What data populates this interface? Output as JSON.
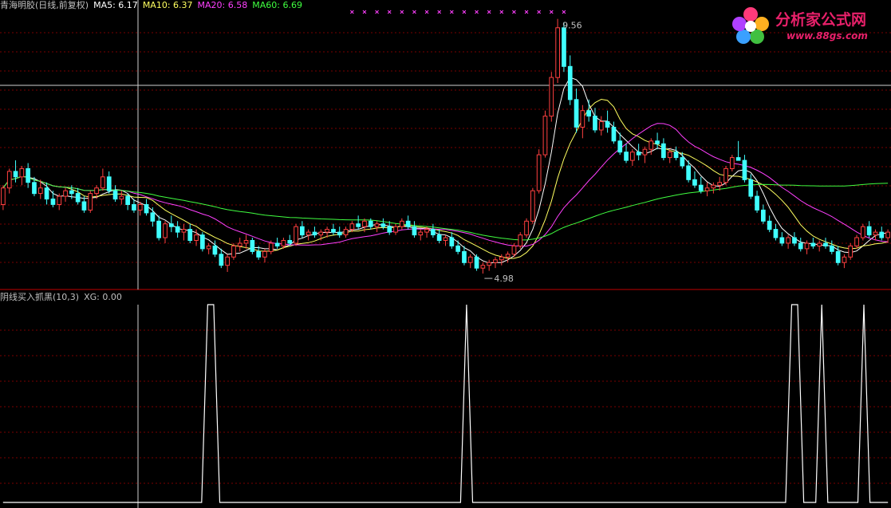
{
  "header": {
    "stock": "青海明胶(日线,前复权)",
    "ma5": "MA5: 6.17",
    "ma10": "MA10: 6.37",
    "ma20": "MA20: 6.58",
    "ma60": "MA60: 6.69"
  },
  "indicator_header": {
    "name": "阴线买入抓黑(10,3)",
    "xg": "XG: 0.00"
  },
  "logo": {
    "text": "分析家公式网",
    "url": "www.88gs.com"
  },
  "colors": {
    "up": "#ff4040",
    "down": "#40ffff",
    "ma5": "#ffffff",
    "ma10": "#ffff60",
    "ma20": "#ff40ff",
    "ma60": "#40ff40",
    "grid": "#7a0000",
    "signal": "#ffffff",
    "logo": "#e8206a"
  },
  "chart_data": [
    {
      "type": "candlestick",
      "title": "青海明胶(日线,前复权)",
      "annotations": [
        {
          "label": "9.56",
          "kind": "high"
        },
        {
          "label": "4.98",
          "kind": "low"
        }
      ],
      "series": [
        {
          "name": "MA5",
          "value": 6.17
        },
        {
          "name": "MA10",
          "value": 6.37
        },
        {
          "name": "MA20",
          "value": 6.58
        },
        {
          "name": "MA60",
          "value": 6.69
        }
      ],
      "ylim": [
        4.85,
        9.7
      ],
      "bars": [
        [
          6.2,
          6.55,
          6.1,
          6.5
        ],
        [
          6.5,
          6.85,
          6.4,
          6.8
        ],
        [
          6.8,
          7.0,
          6.6,
          6.7
        ],
        [
          6.7,
          6.9,
          6.55,
          6.85
        ],
        [
          6.85,
          6.95,
          6.5,
          6.6
        ],
        [
          6.6,
          6.7,
          6.35,
          6.4
        ],
        [
          6.4,
          6.65,
          6.3,
          6.5
        ],
        [
          6.5,
          6.6,
          6.2,
          6.3
        ],
        [
          6.3,
          6.45,
          6.15,
          6.2
        ],
        [
          6.2,
          6.4,
          6.1,
          6.35
        ],
        [
          6.35,
          6.5,
          6.25,
          6.45
        ],
        [
          6.45,
          6.55,
          6.3,
          6.4
        ],
        [
          6.4,
          6.5,
          6.2,
          6.25
        ],
        [
          6.25,
          6.35,
          6.05,
          6.1
        ],
        [
          6.1,
          6.45,
          6.05,
          6.4
        ],
        [
          6.4,
          6.55,
          6.3,
          6.5
        ],
        [
          6.5,
          6.85,
          6.45,
          6.7
        ],
        [
          6.7,
          6.8,
          6.4,
          6.45
        ],
        [
          6.45,
          6.55,
          6.25,
          6.3
        ],
        [
          6.3,
          6.45,
          6.2,
          6.35
        ],
        [
          6.35,
          6.4,
          6.1,
          6.2
        ],
        [
          6.2,
          6.3,
          6.05,
          6.1
        ],
        [
          6.1,
          6.25,
          6.0,
          6.2
        ],
        [
          6.2,
          6.3,
          6.0,
          6.05
        ],
        [
          6.05,
          6.15,
          5.8,
          5.9
        ],
        [
          5.9,
          6.0,
          5.55,
          5.6
        ],
        [
          5.6,
          5.9,
          5.5,
          5.85
        ],
        [
          5.85,
          6.0,
          5.7,
          5.8
        ],
        [
          5.8,
          5.9,
          5.6,
          5.7
        ],
        [
          5.7,
          5.85,
          5.55,
          5.75
        ],
        [
          5.75,
          5.85,
          5.5,
          5.55
        ],
        [
          5.55,
          5.75,
          5.45,
          5.65
        ],
        [
          5.65,
          5.7,
          5.35,
          5.4
        ],
        [
          5.4,
          5.5,
          5.3,
          5.45
        ],
        [
          5.45,
          5.55,
          5.25,
          5.3
        ],
        [
          5.3,
          5.4,
          5.05,
          5.1
        ],
        [
          5.1,
          5.3,
          4.98,
          5.25
        ],
        [
          5.25,
          5.5,
          5.2,
          5.45
        ],
        [
          5.45,
          5.6,
          5.35,
          5.5
        ],
        [
          5.5,
          5.65,
          5.4,
          5.55
        ],
        [
          5.55,
          5.6,
          5.3,
          5.35
        ],
        [
          5.35,
          5.45,
          5.2,
          5.25
        ],
        [
          5.25,
          5.4,
          5.15,
          5.35
        ],
        [
          5.35,
          5.55,
          5.3,
          5.5
        ],
        [
          5.5,
          5.6,
          5.4,
          5.45
        ],
        [
          5.45,
          5.6,
          5.4,
          5.55
        ],
        [
          5.55,
          5.65,
          5.45,
          5.5
        ],
        [
          5.5,
          5.85,
          5.45,
          5.8
        ],
        [
          5.8,
          5.9,
          5.6,
          5.65
        ],
        [
          5.65,
          5.75,
          5.55,
          5.7
        ],
        [
          5.7,
          5.8,
          5.6,
          5.65
        ],
        [
          5.65,
          5.75,
          5.55,
          5.7
        ],
        [
          5.7,
          5.8,
          5.6,
          5.75
        ],
        [
          5.75,
          5.85,
          5.65,
          5.7
        ],
        [
          5.7,
          5.8,
          5.6,
          5.65
        ],
        [
          5.65,
          5.8,
          5.6,
          5.75
        ],
        [
          5.75,
          5.9,
          5.7,
          5.85
        ],
        [
          5.85,
          6.0,
          5.75,
          5.8
        ],
        [
          5.8,
          5.95,
          5.7,
          5.9
        ],
        [
          5.9,
          5.95,
          5.75,
          5.8
        ],
        [
          5.8,
          5.9,
          5.7,
          5.85
        ],
        [
          5.85,
          5.95,
          5.75,
          5.8
        ],
        [
          5.8,
          5.9,
          5.65,
          5.7
        ],
        [
          5.7,
          5.85,
          5.65,
          5.8
        ],
        [
          5.8,
          5.95,
          5.75,
          5.9
        ],
        [
          5.9,
          6.0,
          5.75,
          5.8
        ],
        [
          5.8,
          5.9,
          5.6,
          5.65
        ],
        [
          5.65,
          5.75,
          5.55,
          5.7
        ],
        [
          5.7,
          5.8,
          5.6,
          5.75
        ],
        [
          5.75,
          5.85,
          5.6,
          5.65
        ],
        [
          5.65,
          5.75,
          5.5,
          5.55
        ],
        [
          5.55,
          5.65,
          5.45,
          5.6
        ],
        [
          5.6,
          5.7,
          5.4,
          5.45
        ],
        [
          5.45,
          5.55,
          5.3,
          5.35
        ],
        [
          5.35,
          5.45,
          5.1,
          5.15
        ],
        [
          5.15,
          5.3,
          5.05,
          5.25
        ],
        [
          5.25,
          5.3,
          5.0,
          5.05
        ],
        [
          5.05,
          5.15,
          4.95,
          5.1
        ],
        [
          5.1,
          5.2,
          5.0,
          5.15
        ],
        [
          5.15,
          5.25,
          5.05,
          5.2
        ],
        [
          5.2,
          5.3,
          5.1,
          5.25
        ],
        [
          5.25,
          5.35,
          5.15,
          5.3
        ],
        [
          5.3,
          5.5,
          5.25,
          5.45
        ],
        [
          5.45,
          5.7,
          5.4,
          5.65
        ],
        [
          5.65,
          5.95,
          5.6,
          5.9
        ],
        [
          5.9,
          6.5,
          5.85,
          6.45
        ],
        [
          6.45,
          7.2,
          6.4,
          7.1
        ],
        [
          7.1,
          7.9,
          7.05,
          7.8
        ],
        [
          7.8,
          8.6,
          7.7,
          8.5
        ],
        [
          8.5,
          9.56,
          8.4,
          9.4
        ],
        [
          9.4,
          9.5,
          8.6,
          8.7
        ],
        [
          8.7,
          8.9,
          8.0,
          8.1
        ],
        [
          8.1,
          8.3,
          7.5,
          7.6
        ],
        [
          7.6,
          8.0,
          7.4,
          7.9
        ],
        [
          7.9,
          8.1,
          7.7,
          7.8
        ],
        [
          7.8,
          7.95,
          7.5,
          7.55
        ],
        [
          7.55,
          7.8,
          7.45,
          7.7
        ],
        [
          7.7,
          7.9,
          7.5,
          7.6
        ],
        [
          7.6,
          7.7,
          7.3,
          7.35
        ],
        [
          7.35,
          7.5,
          7.1,
          7.15
        ],
        [
          7.15,
          7.3,
          6.95,
          7.0
        ],
        [
          7.0,
          7.2,
          6.9,
          7.15
        ],
        [
          7.15,
          7.3,
          7.0,
          7.1
        ],
        [
          7.1,
          7.25,
          6.95,
          7.2
        ],
        [
          7.2,
          7.4,
          7.1,
          7.35
        ],
        [
          7.35,
          7.5,
          7.2,
          7.3
        ],
        [
          7.3,
          7.4,
          7.0,
          7.05
        ],
        [
          7.05,
          7.2,
          6.95,
          7.15
        ],
        [
          7.15,
          7.25,
          7.0,
          7.05
        ],
        [
          7.05,
          7.15,
          6.85,
          6.9
        ],
        [
          6.9,
          7.0,
          6.6,
          6.65
        ],
        [
          6.65,
          6.8,
          6.5,
          6.55
        ],
        [
          6.55,
          6.7,
          6.4,
          6.45
        ],
        [
          6.45,
          6.6,
          6.35,
          6.5
        ],
        [
          6.5,
          6.6,
          6.4,
          6.55
        ],
        [
          6.55,
          6.7,
          6.45,
          6.6
        ],
        [
          6.6,
          6.9,
          6.55,
          6.85
        ],
        [
          6.85,
          7.1,
          6.8,
          7.05
        ],
        [
          7.05,
          7.35,
          7.0,
          7.0
        ],
        [
          7.0,
          7.1,
          6.6,
          6.65
        ],
        [
          6.65,
          6.75,
          6.3,
          6.35
        ],
        [
          6.35,
          6.45,
          6.05,
          6.1
        ],
        [
          6.1,
          6.2,
          5.85,
          5.9
        ],
        [
          5.9,
          6.0,
          5.7,
          5.75
        ],
        [
          5.75,
          5.85,
          5.55,
          5.6
        ],
        [
          5.6,
          5.7,
          5.45,
          5.5
        ],
        [
          5.5,
          5.65,
          5.4,
          5.6
        ],
        [
          5.6,
          5.7,
          5.45,
          5.5
        ],
        [
          5.5,
          5.6,
          5.35,
          5.4
        ],
        [
          5.4,
          5.55,
          5.3,
          5.5
        ],
        [
          5.5,
          5.6,
          5.4,
          5.45
        ],
        [
          5.45,
          5.55,
          5.35,
          5.5
        ],
        [
          5.5,
          5.6,
          5.4,
          5.45
        ],
        [
          5.45,
          5.55,
          5.3,
          5.35
        ],
        [
          5.35,
          5.45,
          5.1,
          5.15
        ],
        [
          5.15,
          5.3,
          5.05,
          5.25
        ],
        [
          5.25,
          5.5,
          5.2,
          5.45
        ],
        [
          5.45,
          5.65,
          5.4,
          5.6
        ],
        [
          5.6,
          5.85,
          5.55,
          5.8
        ],
        [
          5.8,
          5.9,
          5.6,
          5.65
        ],
        [
          5.65,
          5.75,
          5.55,
          5.7
        ],
        [
          5.7,
          5.8,
          5.55,
          5.6
        ],
        [
          5.6,
          5.75,
          5.5,
          5.7
        ]
      ]
    },
    {
      "type": "line",
      "title": "阴线买入抓黑(10,3)",
      "ylim": [
        0,
        1
      ],
      "signal_bars": [
        34,
        35,
        77,
        131,
        132,
        136,
        143
      ],
      "bar_count": 148
    }
  ]
}
